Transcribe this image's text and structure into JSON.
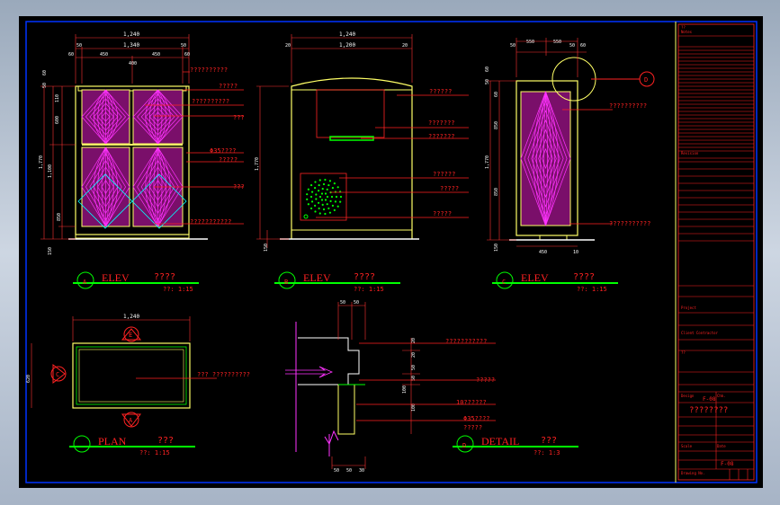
{
  "elevation_a": {
    "dims_top": [
      "1,240",
      "50",
      "1,340",
      "50",
      "60",
      "450",
      "400",
      "450",
      "60"
    ],
    "dims_left": [
      "60",
      "50",
      "110",
      "600",
      "1,770",
      "1,100",
      "850",
      "150"
    ],
    "callouts": [
      "??????????",
      "?????",
      "??????????",
      "???",
      "Φ35????",
      "?????",
      "???",
      "???????????"
    ]
  },
  "elevation_b": {
    "dims_top": [
      "1,240",
      "20",
      "1,200",
      "20"
    ],
    "dims_left": [
      "1,770",
      "150"
    ],
    "callouts": [
      "??????",
      "???????",
      "???????",
      "??????",
      "?????",
      "?????"
    ]
  },
  "elevation_c": {
    "dims_top": [
      "50",
      "550",
      "550",
      "50",
      "60"
    ],
    "dims_left": [
      "60",
      "50",
      "60",
      "850",
      "1,770",
      "850",
      "150"
    ],
    "dims_bottom": [
      "450",
      "10"
    ],
    "callouts": [
      "??????????",
      "???????????"
    ],
    "detail_tag": "D"
  },
  "plan": {
    "dim_top": "1,240",
    "dim_left": "620",
    "callout": "??? ??????????",
    "tag_e": "E",
    "tag_a": "A",
    "tag_c": "C"
  },
  "detail": {
    "dims_top": [
      "50",
      "50"
    ],
    "dims_right": [
      "20",
      "20",
      "50",
      "50",
      "100",
      "100"
    ],
    "dims_bottom": [
      "50",
      "50",
      "30"
    ],
    "callouts": [
      "???????????",
      "?????",
      "10??????",
      "Φ35????",
      "?????"
    ]
  },
  "titles": [
    {
      "tag": "A",
      "name": "ELEV",
      "cn": "????",
      "scale": "??: 1:15"
    },
    {
      "tag": "B",
      "name": "ELEV",
      "cn": "????",
      "scale": "??: 1:15"
    },
    {
      "tag": "C",
      "name": "ELEV",
      "cn": "????",
      "scale": "??: 1:15"
    },
    {
      "tag": "",
      "name": "PLAN",
      "cn": "???",
      "scale": "??: 1:15"
    },
    {
      "tag": "D",
      "name": "DETAIL",
      "cn": "???",
      "scale": "??: 1:3"
    }
  ],
  "title_block": {
    "notes_head": "??",
    "notes_label": "Notes",
    "revision_label": "Revision",
    "project_label": "Project",
    "client_label": "Client Contractor",
    "drawing_title": "??",
    "drawing_no": "F-08",
    "title_cn": "????????",
    "designed_by": "Design",
    "checked_by": "Chk.",
    "scale_label": "Scale",
    "date_label": "Date",
    "drawing_no_label": "Drawing No.",
    "sheet_code": "F-08"
  },
  "colors": {
    "background": "#000000",
    "border": "#0033ff",
    "frame_line": "#ffff66",
    "dimension": "#ffffff",
    "callout": "#ff2222",
    "panel_pattern": "#ff33ff",
    "title_line": "#00ff00",
    "cyan": "#00ffff"
  }
}
